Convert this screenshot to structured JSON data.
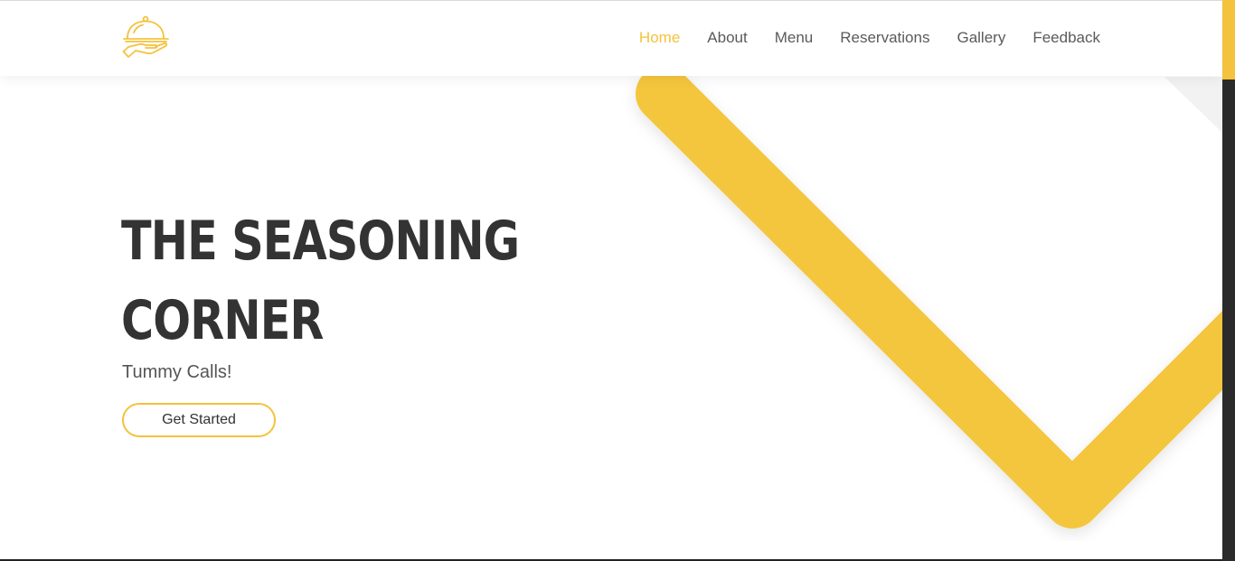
{
  "brand": {
    "logo_icon": "cloche-serving-tray-icon",
    "accent_color": "#f4c23c",
    "text_color": "#333333"
  },
  "nav": {
    "items": [
      {
        "label": "Home",
        "active": true
      },
      {
        "label": "About",
        "active": false
      },
      {
        "label": "Menu",
        "active": false
      },
      {
        "label": "Reservations",
        "active": false
      },
      {
        "label": "Gallery",
        "active": false
      },
      {
        "label": "Feedback",
        "active": false
      }
    ]
  },
  "hero": {
    "title_line1": "THE SEASONING",
    "title_line2": "CORNER",
    "tagline": "Tummy Calls!",
    "cta_label": "Get Started"
  }
}
